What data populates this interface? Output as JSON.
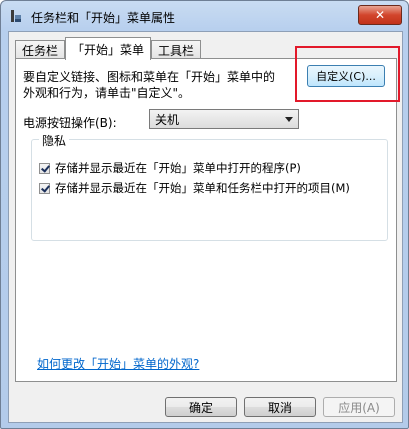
{
  "window": {
    "title": "任务栏和「开始」菜单属性",
    "close_label": "✕"
  },
  "tabs": [
    {
      "label": "任务栏",
      "active": false
    },
    {
      "label": "「开始」菜单",
      "active": true
    },
    {
      "label": "工具栏",
      "active": false
    }
  ],
  "start_menu": {
    "description_line1": "要自定义链接、图标和菜单在「开始」菜单中的",
    "description_line2": "外观和行为，请单击\"自定义\"。",
    "customize_label": "自定义(C)...",
    "power_label": "电源按钮操作(B):",
    "power_value": "关机",
    "privacy_group_label": "隐私",
    "privacy_options": [
      {
        "label": "存储并显示最近在「开始」菜单中打开的程序(P)",
        "checked": true
      },
      {
        "label": "存储并显示最近在「开始」菜单和任务栏中打开的项目(M)",
        "checked": true
      }
    ],
    "help_link": "如何更改「开始」菜单的外观?"
  },
  "buttons": {
    "ok": "确定",
    "cancel": "取消",
    "apply": "应用(A)"
  },
  "colors": {
    "highlight": "#e2192a",
    "link": "#0066cc"
  }
}
